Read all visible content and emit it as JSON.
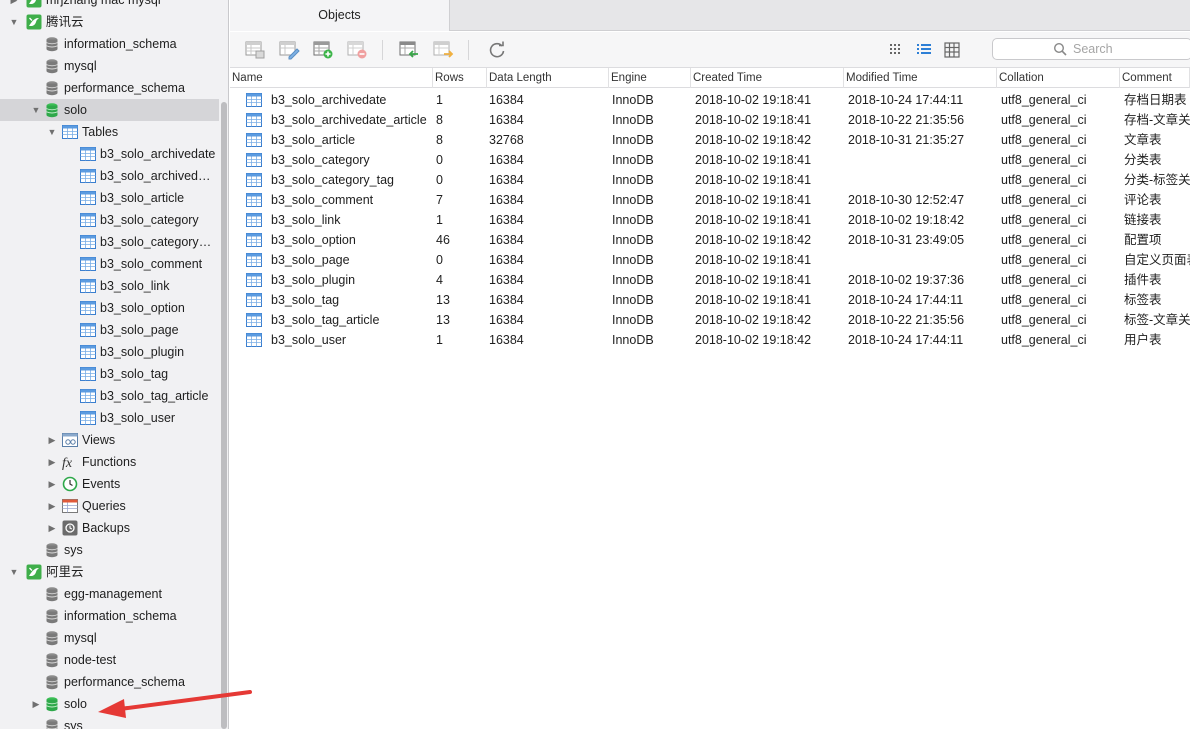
{
  "sidebar": {
    "tree": [
      {
        "id": "conn-mysql-top",
        "label": "mrjzhang mac mysql",
        "icon": "connection-icon",
        "level": 0,
        "expander": "right"
      },
      {
        "id": "conn-tencent",
        "label": "腾讯云",
        "icon": "connection-icon",
        "level": 0,
        "expander": "down"
      },
      {
        "id": "db-information-schema-1",
        "label": "information_schema",
        "icon": "database-icon",
        "level": 1
      },
      {
        "id": "db-mysql-1",
        "label": "mysql",
        "icon": "database-icon",
        "level": 1
      },
      {
        "id": "db-performance-schema-1",
        "label": "performance_schema",
        "icon": "database-icon",
        "level": 1
      },
      {
        "id": "db-solo-1",
        "label": "solo",
        "icon": "database-active-icon",
        "level": 1,
        "expander": "down",
        "selected": true
      },
      {
        "id": "group-tables",
        "label": "Tables",
        "icon": "tables-group-icon",
        "level": 2,
        "expander": "down"
      },
      {
        "id": "tbl-archivedate",
        "label": "b3_solo_archivedate",
        "icon": "table-icon",
        "level": 3
      },
      {
        "id": "tbl-archivedate-article",
        "label": "b3_solo_archivedate_article",
        "icon": "table-icon",
        "level": 3
      },
      {
        "id": "tbl-article",
        "label": "b3_solo_article",
        "icon": "table-icon",
        "level": 3
      },
      {
        "id": "tbl-category",
        "label": "b3_solo_category",
        "icon": "table-icon",
        "level": 3
      },
      {
        "id": "tbl-category-tag",
        "label": "b3_solo_category_tag",
        "icon": "table-icon",
        "level": 3
      },
      {
        "id": "tbl-comment",
        "label": "b3_solo_comment",
        "icon": "table-icon",
        "level": 3
      },
      {
        "id": "tbl-link",
        "label": "b3_solo_link",
        "icon": "table-icon",
        "level": 3
      },
      {
        "id": "tbl-option",
        "label": "b3_solo_option",
        "icon": "table-icon",
        "level": 3
      },
      {
        "id": "tbl-page",
        "label": "b3_solo_page",
        "icon": "table-icon",
        "level": 3
      },
      {
        "id": "tbl-plugin",
        "label": "b3_solo_plugin",
        "icon": "table-icon",
        "level": 3
      },
      {
        "id": "tbl-tag",
        "label": "b3_solo_tag",
        "icon": "table-icon",
        "level": 3
      },
      {
        "id": "tbl-tag-article",
        "label": "b3_solo_tag_article",
        "icon": "table-icon",
        "level": 3
      },
      {
        "id": "tbl-user",
        "label": "b3_solo_user",
        "icon": "table-icon",
        "level": 3
      },
      {
        "id": "group-views",
        "label": "Views",
        "icon": "views-icon",
        "level": 2,
        "expander": "right"
      },
      {
        "id": "group-functions",
        "label": "Functions",
        "icon": "functions-icon",
        "level": 2,
        "expander": "right"
      },
      {
        "id": "group-events",
        "label": "Events",
        "icon": "events-clock-icon",
        "level": 2,
        "expander": "right"
      },
      {
        "id": "group-queries",
        "label": "Queries",
        "icon": "queries-icon",
        "level": 2,
        "expander": "right"
      },
      {
        "id": "group-backups",
        "label": "Backups",
        "icon": "backups-icon",
        "level": 2,
        "expander": "right"
      },
      {
        "id": "db-sys-1",
        "label": "sys",
        "icon": "database-icon",
        "level": 1
      },
      {
        "id": "conn-aliyun",
        "label": "阿里云",
        "icon": "connection-icon",
        "level": 0,
        "expander": "down"
      },
      {
        "id": "db-egg-management",
        "label": "egg-management",
        "icon": "database-icon",
        "level": 1
      },
      {
        "id": "db-information-schema-2",
        "label": "information_schema",
        "icon": "database-icon",
        "level": 1
      },
      {
        "id": "db-mysql-2",
        "label": "mysql",
        "icon": "database-icon",
        "level": 1
      },
      {
        "id": "db-node-test",
        "label": "node-test",
        "icon": "database-icon",
        "level": 1
      },
      {
        "id": "db-performance-schema-2",
        "label": "performance_schema",
        "icon": "database-icon",
        "level": 1
      },
      {
        "id": "db-solo-2",
        "label": "solo",
        "icon": "database-active-icon",
        "level": 1,
        "expander": "right"
      },
      {
        "id": "db-sys-2",
        "label": "sys",
        "icon": "database-icon",
        "level": 1
      }
    ]
  },
  "tabs": [
    {
      "label": "Objects",
      "active": true
    }
  ],
  "toolbar": {
    "buttons": [
      "open-table-icon",
      "design-table-icon",
      "new-table-icon",
      "delete-table-icon",
      "import-wizard-icon",
      "export-wizard-icon",
      "refresh-icon"
    ],
    "view_modes": [
      "grid-view-icon",
      "list-view-icon",
      "detail-view-icon"
    ],
    "search_placeholder": "Search"
  },
  "table": {
    "columns": [
      "Name",
      "Rows",
      "Data Length",
      "Engine",
      "Created Time",
      "Modified Time",
      "Collation",
      "Comment"
    ],
    "rows": [
      [
        "b3_solo_archivedate",
        "1",
        "16384",
        "InnoDB",
        "2018-10-02 19:18:41",
        "2018-10-24 17:44:11",
        "utf8_general_ci",
        "存档日期表"
      ],
      [
        "b3_solo_archivedate_article",
        "8",
        "16384",
        "InnoDB",
        "2018-10-02 19:18:41",
        "2018-10-22 21:35:56",
        "utf8_general_ci",
        "存档-文章关联表"
      ],
      [
        "b3_solo_article",
        "8",
        "32768",
        "InnoDB",
        "2018-10-02 19:18:42",
        "2018-10-31 21:35:27",
        "utf8_general_ci",
        "文章表"
      ],
      [
        "b3_solo_category",
        "0",
        "16384",
        "InnoDB",
        "2018-10-02 19:18:41",
        "",
        "utf8_general_ci",
        "分类表"
      ],
      [
        "b3_solo_category_tag",
        "0",
        "16384",
        "InnoDB",
        "2018-10-02 19:18:41",
        "",
        "utf8_general_ci",
        "分类-标签关联表"
      ],
      [
        "b3_solo_comment",
        "7",
        "16384",
        "InnoDB",
        "2018-10-02 19:18:41",
        "2018-10-30 12:52:47",
        "utf8_general_ci",
        "评论表"
      ],
      [
        "b3_solo_link",
        "1",
        "16384",
        "InnoDB",
        "2018-10-02 19:18:41",
        "2018-10-02 19:18:42",
        "utf8_general_ci",
        "链接表"
      ],
      [
        "b3_solo_option",
        "46",
        "16384",
        "InnoDB",
        "2018-10-02 19:18:42",
        "2018-10-31 23:49:05",
        "utf8_general_ci",
        "配置项"
      ],
      [
        "b3_solo_page",
        "0",
        "16384",
        "InnoDB",
        "2018-10-02 19:18:41",
        "",
        "utf8_general_ci",
        "自定义页面表"
      ],
      [
        "b3_solo_plugin",
        "4",
        "16384",
        "InnoDB",
        "2018-10-02 19:18:41",
        "2018-10-02 19:37:36",
        "utf8_general_ci",
        "插件表"
      ],
      [
        "b3_solo_tag",
        "13",
        "16384",
        "InnoDB",
        "2018-10-02 19:18:41",
        "2018-10-24 17:44:11",
        "utf8_general_ci",
        "标签表"
      ],
      [
        "b3_solo_tag_article",
        "13",
        "16384",
        "InnoDB",
        "2018-10-02 19:18:42",
        "2018-10-22 21:35:56",
        "utf8_general_ci",
        "标签-文章关联表"
      ],
      [
        "b3_solo_user",
        "1",
        "16384",
        "InnoDB",
        "2018-10-02 19:18:42",
        "2018-10-24 17:44:11",
        "utf8_general_ci",
        "用户表"
      ]
    ]
  },
  "colors": {
    "accent": "#2d7fd6",
    "annotation": "#e53935",
    "db_green": "#2ea84a",
    "db_gray": "#7a7a7a"
  }
}
